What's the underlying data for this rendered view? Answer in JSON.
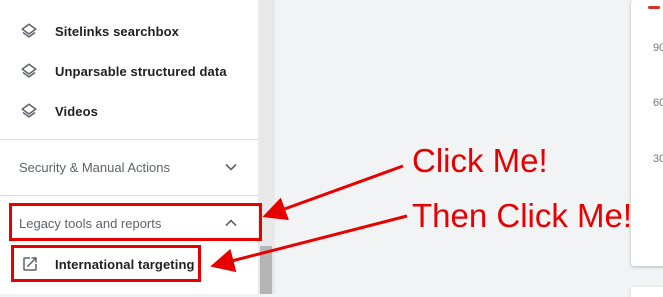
{
  "sidebar": {
    "items": [
      {
        "label": "Sitelinks searchbox",
        "icon": "layers-icon"
      },
      {
        "label": "Unparsable structured data",
        "icon": "layers-icon"
      },
      {
        "label": "Videos",
        "icon": "layers-icon"
      }
    ],
    "security_section": {
      "label": "Security & Manual Actions",
      "icon": "chevron-down-icon"
    },
    "legacy_section": {
      "label": "Legacy tools and reports",
      "icon": "chevron-up-icon"
    },
    "legacy_items": [
      {
        "label": "International targeting",
        "icon": "open-in-new-icon"
      }
    ]
  },
  "chart_card": {
    "ticks": [
      "90",
      "60",
      "30"
    ],
    "accent_color": "#d93025"
  },
  "annotations": {
    "callout_1": "Click Me!",
    "callout_2": "Then Click Me!",
    "color": "#e60000"
  }
}
